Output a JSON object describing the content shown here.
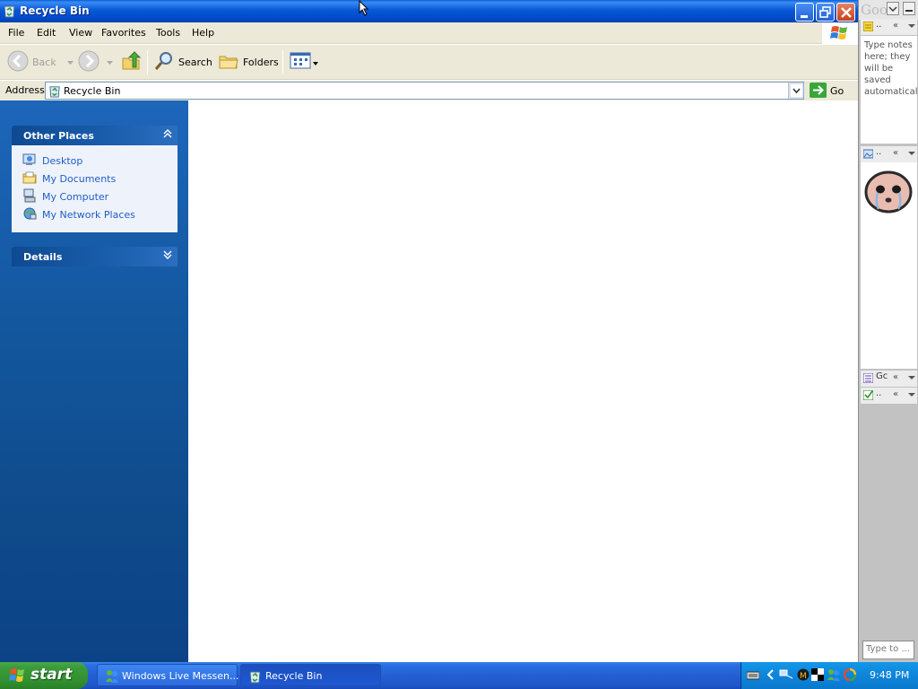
{
  "window": {
    "title": "Recycle Bin"
  },
  "menubar": {
    "items": [
      "File",
      "Edit",
      "View",
      "Favorites",
      "Tools",
      "Help"
    ]
  },
  "toolbar": {
    "back_label": "Back",
    "search_label": "Search",
    "folders_label": "Folders"
  },
  "address": {
    "label": "Address",
    "value": "Recycle Bin",
    "go_label": "Go"
  },
  "taskpane": {
    "other_places": {
      "title": "Other Places",
      "links": [
        "Desktop",
        "My Documents",
        "My Computer",
        "My Network Places"
      ]
    },
    "details": {
      "title": "Details"
    }
  },
  "sidebar": {
    "logo": "Goo",
    "notes_text": "Type notes here; they will be saved automatically.",
    "todo_title": "Gc",
    "search_placeholder": "Type to ..."
  },
  "taskbar": {
    "start_label": "start",
    "tasks": [
      {
        "label": "Windows Live Messen...",
        "icon": "messenger-icon"
      },
      {
        "label": "Recycle Bin",
        "icon": "recycle-bin-icon"
      }
    ],
    "clock": "9:48 PM"
  },
  "colors": {
    "title_bar": "#0858d8",
    "task_pane": "#13579e",
    "start_button": "#31902f",
    "link": "#215dc6"
  }
}
